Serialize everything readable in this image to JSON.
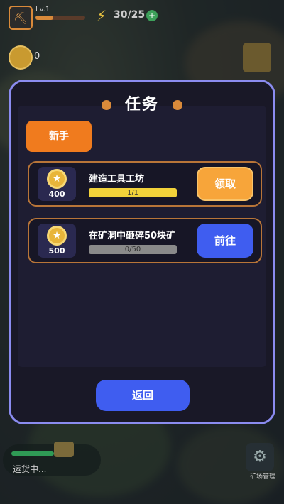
{
  "hud": {
    "level": "Lv.1",
    "energy": "30/25",
    "energy_plus": "+",
    "coins": "0"
  },
  "dialog": {
    "title": "任务",
    "tab_label": "新手",
    "tasks": [
      {
        "reward": "400",
        "title": "建造工具工坊",
        "progress_label": "1/1",
        "progress": 1.0,
        "button": "领取"
      },
      {
        "reward": "500",
        "title": "在矿洞中砸碎50块矿",
        "progress_label": "0/50",
        "progress": 0.0,
        "button": "前往"
      }
    ],
    "back_label": "返回"
  },
  "bottom": {
    "status": "运货中...",
    "gear_label": "矿场管理"
  },
  "colors": {
    "accent_orange": "#f07b1e",
    "accent_blue": "#3f5df0",
    "dialog_border": "#8b8cf0",
    "progress_fill": "#f2d23a"
  }
}
